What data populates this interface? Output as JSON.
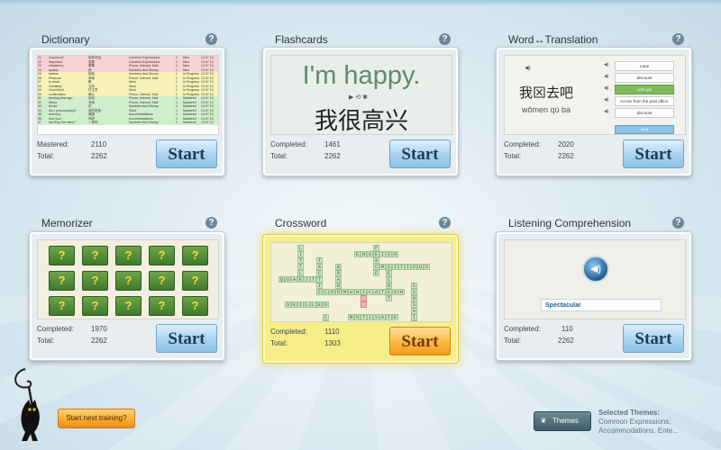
{
  "dictionary": {
    "title": "Dictionary",
    "help": "?",
    "stats": {
      "mastered_label": "Mastered:",
      "mastered": "2110",
      "total_label": "Total:",
      "total": "2262"
    },
    "start_label": "Start",
    "rows": [
      {
        "n": "21",
        "w": "Good luck!",
        "t": "祝你好运",
        "cat": "Common Expressions",
        "s": "New",
        "d": "13.07.13"
      },
      {
        "n": "22",
        "w": "important",
        "t": "重要",
        "cat": "Common Expressions",
        "s": "New",
        "d": "13.07.13"
      },
      {
        "n": "23",
        "w": "strawberry",
        "t": "草莓",
        "cat": "Phone, Internet, Mail",
        "s": "New",
        "d": "13.07.13"
      },
      {
        "n": "24",
        "w": "quickly",
        "t": "快",
        "cat": "Numbers And Money",
        "s": "New",
        "d": "13.07.13"
      },
      {
        "n": "25",
        "w": "believe",
        "t": "相信",
        "cat": "Numbers And Money",
        "s": "In Progress",
        "d": "13.07.13"
      },
      {
        "n": "26",
        "w": "Pleasure",
        "t": "荣幸",
        "cat": "Phone, Internet, Mail",
        "s": "In Progress",
        "d": "13.07.13"
      },
      {
        "n": "27",
        "w": "to teach",
        "t": "教",
        "cat": "Work",
        "s": "In Progress",
        "d": "13.07.13"
      },
      {
        "n": "28",
        "w": "Certainly!",
        "t": "当然",
        "cat": "Work",
        "s": "In Progress",
        "d": "13.07.13"
      },
      {
        "n": "29",
        "w": "Good idea!",
        "t": "好主意",
        "cat": "Work",
        "s": "In Progress",
        "d": "13.07.13"
      },
      {
        "n": "30",
        "w": "confirmation",
        "t": "确认",
        "cat": "Phone, Internet, Mail",
        "s": "In Progress",
        "d": "13.07.13"
      },
      {
        "n": "31",
        "w": "Arriving time ago.",
        "t": "到达",
        "cat": "Phone, Internet, Mail",
        "s": "Mastered",
        "d": "13.07.13"
      },
      {
        "n": "32",
        "w": "Africa",
        "t": "非洲",
        "cat": "Phone, Internet, Mail",
        "s": "Mastered",
        "d": "13.07.13"
      },
      {
        "n": "33",
        "w": "At ldw",
        "t": "在",
        "cat": "Numbers And Money",
        "s": "Mastered",
        "d": "13.07.13"
      },
      {
        "n": "34",
        "w": "Am I pronouncing it",
        "t": "我的发音",
        "cat": "Work",
        "s": "Mastered",
        "d": "13.07.13"
      },
      {
        "n": "35",
        "w": "America",
        "t": "美国",
        "cat": "Accommodations",
        "s": "Mastered",
        "d": "13.07.13"
      },
      {
        "n": "36",
        "w": "And you?",
        "t": "你呢",
        "cat": "Accommodations",
        "s": "Mastered",
        "d": "13.07.13"
      },
      {
        "n": "37",
        "w": "Are they the same?",
        "t": "一样吗",
        "cat": "Numbers And Money",
        "s": "Mastered",
        "d": "13.07.13"
      }
    ]
  },
  "flashcards": {
    "title": "Flashcards",
    "help": "?",
    "english": "I'm happy.",
    "chinese": "我很高兴",
    "stats": {
      "completed_label": "Completed:",
      "completed": "1461",
      "total_label": "Total:",
      "total": "2262"
    },
    "start_label": "Start"
  },
  "word_translation": {
    "title": "Word↔Translation",
    "help": "?",
    "chinese": "我⊠去吧",
    "pinyin": "wǒmen qù ba",
    "options": [
      "route",
      "discount",
      "Let's go!",
      "Across from the post office.",
      "discount"
    ],
    "next": "Next",
    "stats": {
      "completed_label": "Completed:",
      "completed": "2020",
      "total_label": "Total:",
      "total": "2262"
    },
    "start_label": "Start"
  },
  "memorizer": {
    "title": "Memorizer",
    "help": "?",
    "tile": "?",
    "stats": {
      "completed_label": "Completed:",
      "completed": "1970",
      "total_label": "Total:",
      "total": "2262"
    },
    "start_label": "Start"
  },
  "crossword": {
    "title": "Crossword",
    "help": "?",
    "stats": {
      "completed_label": "Completed:",
      "completed": "1110",
      "total_label": "Total:",
      "total": "1303"
    },
    "start_label": "Start"
  },
  "listening": {
    "title": "Listening Comprehension",
    "help": "?",
    "answer": "Spectacular",
    "stats": {
      "completed_label": "Completed:",
      "completed": "110",
      "total_label": "Total:",
      "total": "2262"
    },
    "start_label": "Start"
  },
  "bottom": {
    "next_training": "Start next training?",
    "themes": "Themes",
    "selected_title": "Selected Themes:",
    "selected_text": "Common Expressions, Accommodations, Ente..."
  },
  "colors": {
    "start_blue": "#a9d2ef",
    "start_orange": "#fbb845",
    "highlight": "#f6ef88",
    "tile_green": "#3f7a2b"
  }
}
